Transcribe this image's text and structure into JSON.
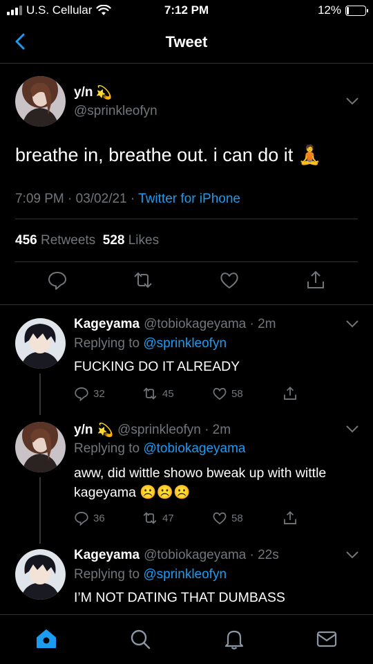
{
  "status_bar": {
    "carrier": "U.S. Cellular",
    "time": "7:12 PM",
    "battery": "12%",
    "battery_level": 0.12
  },
  "header": {
    "title": "Tweet",
    "back_icon": "chevron-left-icon"
  },
  "main_tweet": {
    "name": "y/n",
    "name_emoji": "💫",
    "handle": "@sprinkleofyn",
    "text": "breathe in, breathe out. i can do it",
    "text_emoji": "🧘",
    "time": "7:09 PM · 03/02/21 · ",
    "source": "Twitter for iPhone",
    "retweets_count": "456",
    "retweets_label": "Retweets",
    "likes_count": "528",
    "likes_label": "Likes",
    "actions": [
      "reply-icon",
      "retweet-icon",
      "like-icon",
      "share-icon"
    ]
  },
  "replies": [
    {
      "name": "Kageyama",
      "handle": "@tobiokageyama · 2m",
      "replying_prefix": "Replying to ",
      "replying_to": "@sprinkleofyn",
      "text": "FUCKING DO IT ALREADY",
      "replies": "32",
      "retweets": "45",
      "likes": "58"
    },
    {
      "name": "y/n",
      "name_emoji": "💫",
      "handle": "@sprinkleofyn · 2m",
      "replying_prefix": "Replying to ",
      "replying_to": "@tobiokageyama",
      "text": "aww, did wittle showo bweak up with wittle kageyama",
      "text_emoji": "☹️☹️☹️",
      "replies": "36",
      "retweets": "47",
      "likes": "58"
    },
    {
      "name": "Kageyama",
      "handle": "@tobiokageyama · 22s",
      "replying_prefix": "Replying to ",
      "replying_to": "@sprinkleofyn",
      "text": "I’M NOT DATING THAT DUMBASS"
    }
  ],
  "bottom_nav": [
    "home-icon",
    "search-icon",
    "notifications-icon",
    "messages-icon"
  ],
  "colors": {
    "background": "#000000",
    "link": "#1d9bf0",
    "muted": "#71767b",
    "active_nav": "#1d9bf0"
  }
}
